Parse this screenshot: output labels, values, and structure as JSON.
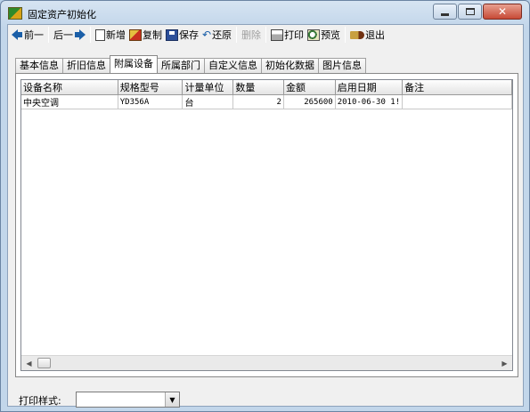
{
  "window": {
    "title": "固定资产初始化",
    "controls": {
      "minimize": "minimize-icon",
      "maximize": "maximize-icon",
      "close": "close-icon"
    }
  },
  "toolbar": {
    "prev": "前一",
    "next": "后一",
    "new": "新增",
    "copy": "复制",
    "save": "保存",
    "restore": "还原",
    "delete": "删除",
    "print": "打印",
    "preview": "预览",
    "exit": "退出"
  },
  "tabs": [
    {
      "label": "基本信息",
      "active": false
    },
    {
      "label": "折旧信息",
      "active": false
    },
    {
      "label": "附属设备",
      "active": true
    },
    {
      "label": "所属部门",
      "active": false
    },
    {
      "label": "自定义信息",
      "active": false
    },
    {
      "label": "初始化数据",
      "active": false
    },
    {
      "label": "图片信息",
      "active": false
    }
  ],
  "grid": {
    "columns": [
      "设备名称",
      "规格型号",
      "计量单位",
      "数量",
      "金额",
      "启用日期",
      "备注"
    ],
    "rows": [
      [
        "中央空调",
        "YD356A",
        "台",
        "2",
        "265600",
        "2010-06-30 1!",
        ""
      ]
    ]
  },
  "footer": {
    "print_style_label": "打印样式:",
    "print_style_value": ""
  },
  "colors": {
    "title_bar": "#c2d6ea",
    "close_button": "#c74a36",
    "arrow_blue": "#1b5fa8"
  }
}
